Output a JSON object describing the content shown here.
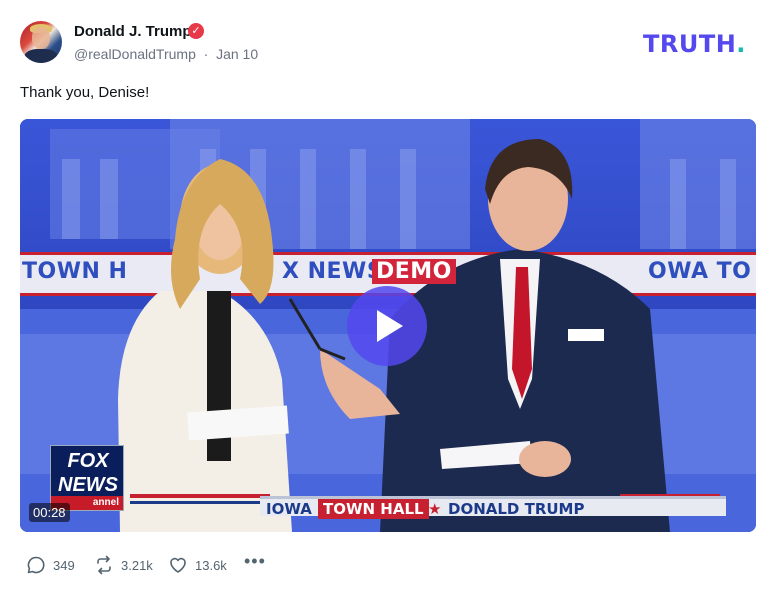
{
  "author": {
    "name": "Donald J. Trump",
    "handle": "@realDonaldTrump",
    "date": "Jan 10",
    "verified_icon": "verified-badge-icon"
  },
  "brand": {
    "logo_text": "TRUTH",
    "logo_dot": ".",
    "logo_color": "#5448ee",
    "dot_color": "#17b9b0"
  },
  "post": {
    "text": "Thank you, Denise!"
  },
  "video": {
    "timecode": "00:28",
    "play_icon": "play-icon",
    "stage_banner": {
      "left": "TOWN H",
      "middle": "X NEWS",
      "demo": "DEMO",
      "right": "OWA TO"
    },
    "network_logo": {
      "line1": "FOX",
      "line2": "NEWS",
      "line3": "annel"
    },
    "chyron": {
      "iowa": "IOWA",
      "town_hall": "TOWN HALL",
      "star": "★",
      "name": "DONALD TRUMP"
    }
  },
  "actions": {
    "replies": "349",
    "reposts": "3.21k",
    "likes": "13.6k",
    "more": "•••"
  }
}
